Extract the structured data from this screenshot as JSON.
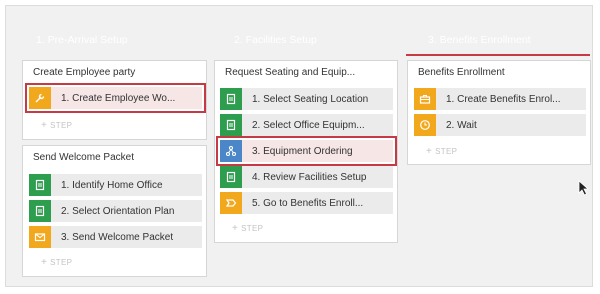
{
  "colors": {
    "stage_header": "#5c5c5c",
    "stage_header_active": "#6e6e6e",
    "accent_underline": "#c63a45",
    "highlight_border": "#c63a45",
    "icon_green": "#2d9d4e",
    "icon_orange": "#f2a81d",
    "icon_blue": "#4a86c8"
  },
  "stages": [
    {
      "label": "1.  Pre-Arrival Setup"
    },
    {
      "label": "2.  Facilities Setup"
    },
    {
      "label": "3.  Benefits Enrollment"
    }
  ],
  "add_step_label": "STEP",
  "processes": {
    "create_employee_party": {
      "title": "Create Employee party",
      "steps": [
        {
          "label": "1.  Create Employee Wo...",
          "icon": "wrench-icon",
          "color": "orange"
        }
      ]
    },
    "send_welcome_packet": {
      "title": "Send Welcome Packet",
      "steps": [
        {
          "label": "1.  Identify Home Office",
          "icon": "form-icon",
          "color": "green"
        },
        {
          "label": "2.  Select Orientation Plan",
          "icon": "form-icon",
          "color": "green"
        },
        {
          "label": "3.  Send Welcome Packet",
          "icon": "envelope-icon",
          "color": "orange"
        }
      ]
    },
    "request_seating": {
      "title": "Request Seating and Equip...",
      "steps": [
        {
          "label": "1.  Select Seating Location",
          "icon": "form-icon",
          "color": "green"
        },
        {
          "label": "2.  Select Office Equipm...",
          "icon": "form-icon",
          "color": "green"
        },
        {
          "label": "3.  Equipment Ordering",
          "icon": "subprocess-icon",
          "color": "blue"
        },
        {
          "label": "4.  Review Facilities Setup",
          "icon": "form-icon",
          "color": "green"
        },
        {
          "label": "5.  Go to Benefits Enroll...",
          "icon": "change-stage-icon",
          "color": "orange"
        }
      ]
    },
    "benefits_enrollment": {
      "title": "Benefits Enrollment",
      "steps": [
        {
          "label": "1.  Create Benefits Enrol...",
          "icon": "briefcase-icon",
          "color": "orange"
        },
        {
          "label": "2.  Wait",
          "icon": "clock-icon",
          "color": "orange"
        }
      ]
    }
  }
}
